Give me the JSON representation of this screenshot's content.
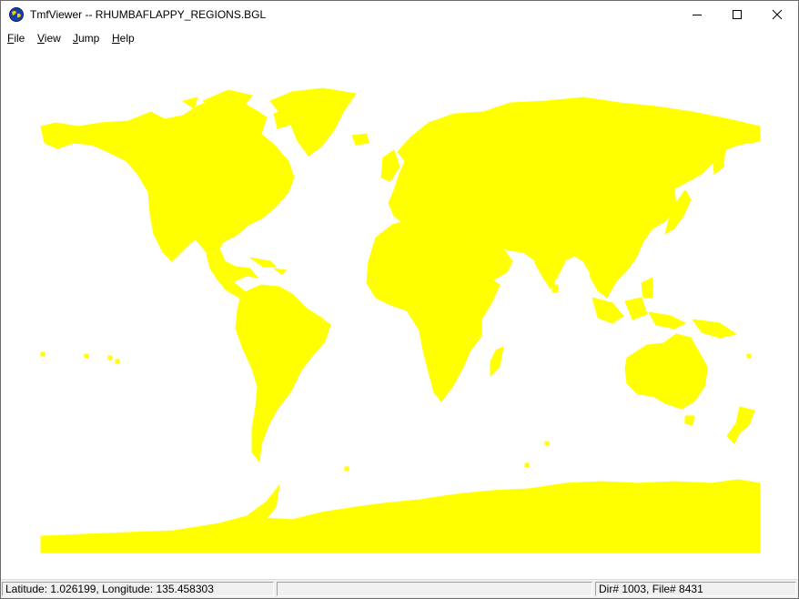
{
  "window": {
    "title": "TmfViewer -- RHUMBAFLAPPY_REGIONS.BGL",
    "icon": "globe-icon",
    "controls": [
      "minimize-icon",
      "maximize-icon",
      "close-icon"
    ]
  },
  "menu": {
    "items": [
      {
        "accel": "F",
        "rest": "ile"
      },
      {
        "accel": "V",
        "rest": "iew"
      },
      {
        "accel": "J",
        "rest": "ump"
      },
      {
        "accel": "H",
        "rest": "elp"
      }
    ]
  },
  "map": {
    "land_color": "#ffff00",
    "background_color": "#ffffff"
  },
  "status": {
    "latlon": "Latitude: 1.026199, Longitude: 135.458303",
    "middle": "",
    "file_info": "Dir# 1003, File# 8431"
  }
}
